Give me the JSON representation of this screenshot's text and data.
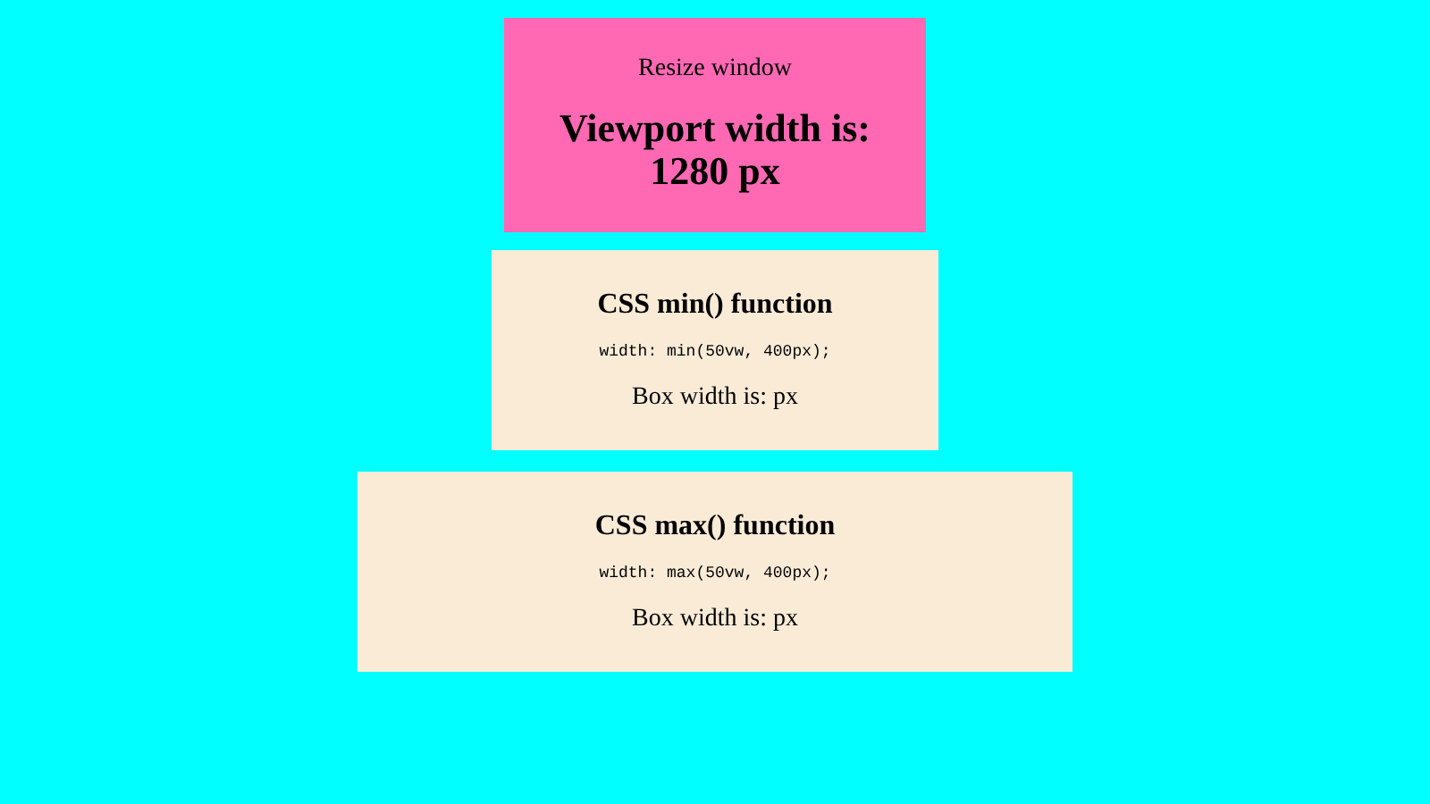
{
  "header": {
    "caption": "Resize window",
    "heading": "Viewport width is: 1280 px"
  },
  "boxes": [
    {
      "title": "CSS min() function",
      "code": "width: min(50vw, 400px);",
      "readout": "Box width is: px"
    },
    {
      "title": "CSS max() function",
      "code": "width: max(50vw, 400px);",
      "readout": "Box width is: px"
    }
  ]
}
